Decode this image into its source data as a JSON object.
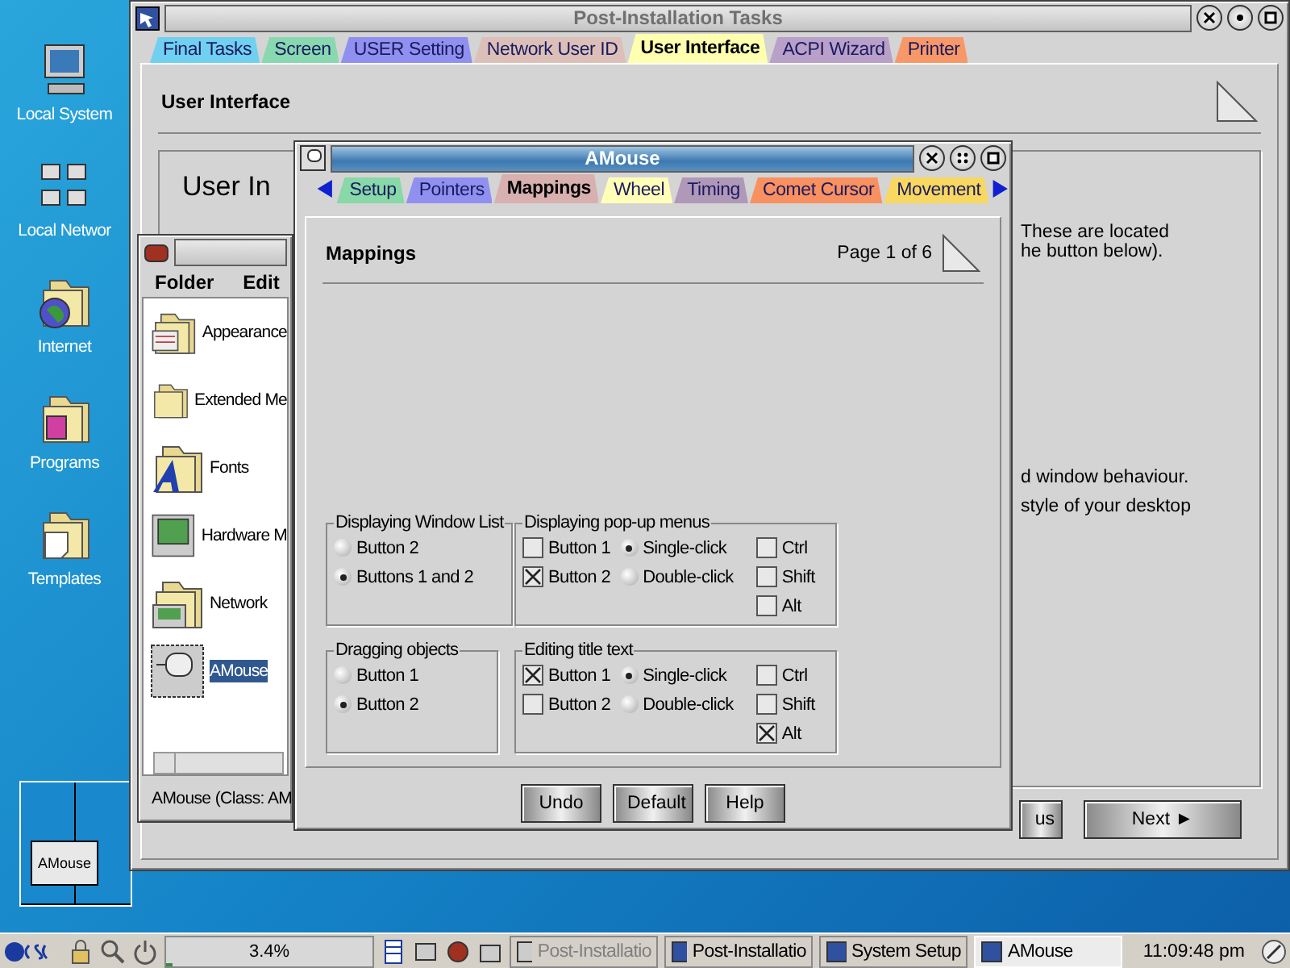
{
  "desktop_icons": [
    {
      "label": "Local System"
    },
    {
      "label": "Local Networ"
    },
    {
      "label": "Internet"
    },
    {
      "label": "Programs"
    },
    {
      "label": "Templates"
    }
  ],
  "pager": {
    "window_label": "AMouse"
  },
  "setup_window": {
    "title": "Post-Installation Tasks",
    "tabs": [
      {
        "label": "Final Tasks",
        "color": "#70d0f0",
        "selected": false
      },
      {
        "label": "Screen",
        "color": "#88d8b0",
        "selected": false
      },
      {
        "label": "USER Setting",
        "color": "#9090f0",
        "selected": false
      },
      {
        "label": "Network User ID",
        "color": "#dcc0b8",
        "selected": false
      },
      {
        "label": "User Interface",
        "color": "#ffffb0",
        "selected": true
      },
      {
        "label": "ACPI Wizard",
        "color": "#b8a0c8",
        "selected": false
      },
      {
        "label": "Printer",
        "color": "#f89868",
        "selected": false
      }
    ],
    "page_title": "User Interface",
    "heading": "User In",
    "text_lines": [
      "These are located",
      "he button below).",
      "d window behaviour.",
      "style of your desktop"
    ],
    "buttons": [
      "us",
      "Next ►"
    ]
  },
  "folder_window": {
    "menu": [
      "Folder",
      "Edit"
    ],
    "items": [
      {
        "label": "Appearance",
        "selected": false
      },
      {
        "label": "Extended Me",
        "selected": false
      },
      {
        "label": "Fonts",
        "selected": false
      },
      {
        "label": "Hardware M",
        "selected": false
      },
      {
        "label": "Network",
        "selected": false
      },
      {
        "label": "AMouse",
        "selected": true
      }
    ],
    "status": "AMouse (Class: AM"
  },
  "amouse_window": {
    "title": "AMouse",
    "tabs": [
      {
        "label": "Setup",
        "color": "#88d8a8",
        "selected": false
      },
      {
        "label": "Pointers",
        "color": "#9090f0",
        "selected": false
      },
      {
        "label": "Mappings",
        "color": "#d8b0b0",
        "selected": true
      },
      {
        "label": "Wheel",
        "color": "#ffffb8",
        "selected": false
      },
      {
        "label": "Timing",
        "color": "#b098b8",
        "selected": false
      },
      {
        "label": "Comet Cursor",
        "color": "#f89060",
        "selected": false
      },
      {
        "label": "Movement",
        "color": "#f8d860",
        "selected": false
      }
    ],
    "page_title": "Mappings",
    "page_indicator": "Page 1 of 6",
    "groups": [
      {
        "title": "Displaying Window List",
        "columns": [
          [
            {
              "kind": "radio",
              "label": "Button 2",
              "selected": false
            },
            {
              "kind": "radio",
              "label": "Buttons 1 and 2",
              "selected": true
            }
          ]
        ]
      },
      {
        "title": "Displaying pop-up menus",
        "columns": [
          [
            {
              "kind": "checkbox",
              "label": "Button 1",
              "checked": false
            },
            {
              "kind": "checkbox",
              "label": "Button 2",
              "checked": true
            }
          ],
          [
            {
              "kind": "radio",
              "label": "Single-click",
              "selected": true
            },
            {
              "kind": "radio",
              "label": "Double-click",
              "selected": false
            }
          ],
          [
            {
              "kind": "checkbox",
              "label": "Ctrl",
              "checked": false
            },
            {
              "kind": "checkbox",
              "label": "Shift",
              "checked": false
            },
            {
              "kind": "checkbox",
              "label": "Alt",
              "checked": false
            }
          ]
        ]
      },
      {
        "title": "Dragging objects",
        "columns": [
          [
            {
              "kind": "radio",
              "label": "Button 1",
              "selected": false
            },
            {
              "kind": "radio",
              "label": "Button 2",
              "selected": true
            }
          ]
        ]
      },
      {
        "title": "Editing title text",
        "columns": [
          [
            {
              "kind": "checkbox",
              "label": "Button 1",
              "checked": true
            },
            {
              "kind": "checkbox",
              "label": "Button 2",
              "checked": false
            }
          ],
          [
            {
              "kind": "radio",
              "label": "Single-click",
              "selected": true
            },
            {
              "kind": "radio",
              "label": "Double-click",
              "selected": false
            }
          ],
          [
            {
              "kind": "checkbox",
              "label": "Ctrl",
              "checked": false
            },
            {
              "kind": "checkbox",
              "label": "Shift",
              "checked": false
            },
            {
              "kind": "checkbox",
              "label": "Alt",
              "checked": true
            }
          ]
        ]
      }
    ],
    "buttons": [
      "Undo",
      "Default",
      "Help"
    ]
  },
  "taskbar": {
    "cpu_reading": "3.4%",
    "level": 0.034,
    "tasks": [
      {
        "label": "Post-Installatio",
        "selected": false,
        "disabled": true
      },
      {
        "label": "Post-Installatio",
        "selected": false,
        "disabled": false
      },
      {
        "label": "System Setup",
        "selected": false,
        "disabled": false
      },
      {
        "label": "AMouse",
        "selected": true,
        "disabled": false
      }
    ],
    "clock": "11:09:48 pm"
  }
}
